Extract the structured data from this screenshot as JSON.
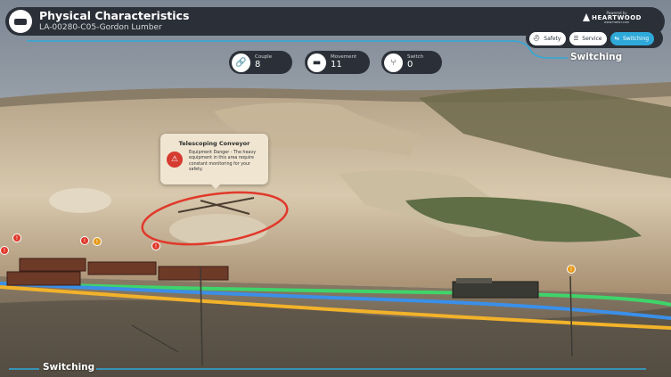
{
  "header": {
    "title": "Physical Characteristics",
    "subtitle": "LA-00280-C05-Gordon Lumber",
    "brand": {
      "powered": "Powered by",
      "name": "HEARTWOOD",
      "url": "www.hwdvr.com"
    }
  },
  "modes": [
    {
      "label": "Safety",
      "icon": "hardhat-icon",
      "active": false
    },
    {
      "label": "Service",
      "icon": "list-icon",
      "active": false
    },
    {
      "label": "Switching",
      "icon": "train-switch-icon",
      "active": true
    }
  ],
  "current_mode_label": "Switching",
  "stats": [
    {
      "label": "Couple",
      "value": "8",
      "icon": "link-icon"
    },
    {
      "label": "Movement",
      "value": "11",
      "icon": "railcar-icon"
    },
    {
      "label": "Switch",
      "value": "0",
      "icon": "track-switch-icon"
    }
  ],
  "tooltip": {
    "title": "Telescoping Conveyor",
    "body": "Equipment Danger - The heavy equipment in this area require constant monitoring for your safety.",
    "icon": "warning-icon"
  },
  "footer_label": "Switching",
  "colors": {
    "panel": "#2b3038",
    "accent": "#2fa9d9",
    "track_green": "#3fd46a",
    "track_blue": "#3b8fe8",
    "track_orange": "#f2b22a",
    "hazard_red": "#e0392b"
  }
}
